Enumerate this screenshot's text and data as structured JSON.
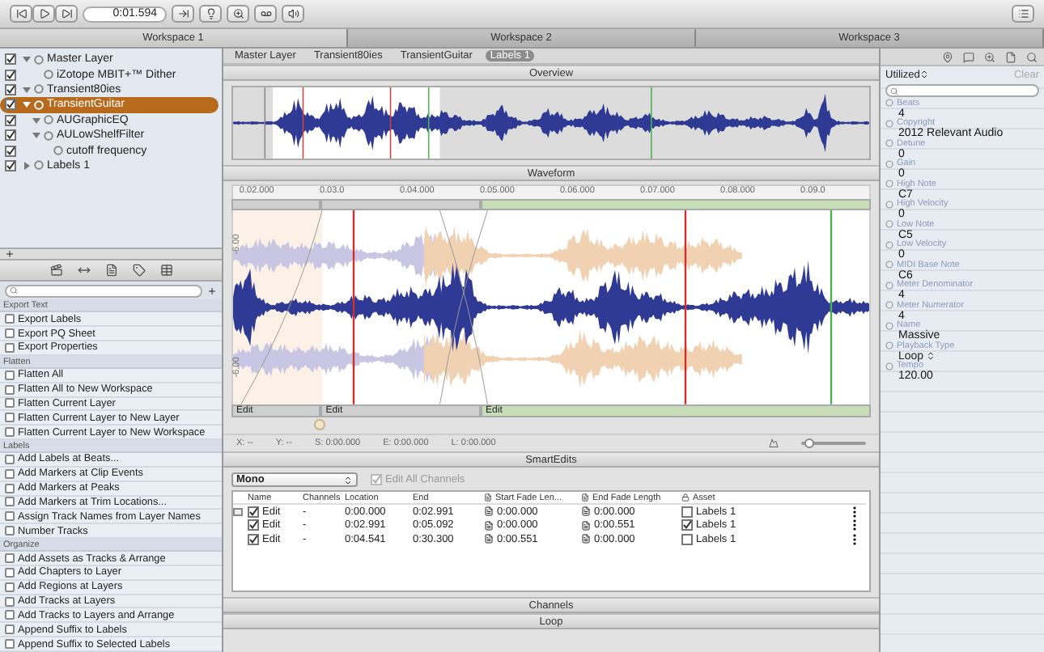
{
  "toolbar": {
    "time": "0:01.594"
  },
  "workspace_tabs": [
    {
      "label": "Workspace 1",
      "selected": true
    },
    {
      "label": "Workspace 2",
      "selected": false
    },
    {
      "label": "Workspace 3",
      "selected": false
    }
  ],
  "layers": [
    {
      "label": "Master Layer",
      "checked": true,
      "expanded": true,
      "selected": false,
      "children": [
        {
          "label": "iZotope MBIT+™ Dither",
          "checked": true,
          "selected": false
        }
      ]
    },
    {
      "label": "Transient80ies",
      "checked": true,
      "expanded": true,
      "selected": false
    },
    {
      "label": "TransientGuitar",
      "checked": true,
      "expanded": true,
      "selected": true,
      "children": [
        {
          "label": "AUGraphicEQ",
          "checked": true,
          "expanded": true,
          "selected": false
        },
        {
          "label": "AULowShelfFilter",
          "checked": true,
          "expanded": true,
          "selected": false,
          "children": [
            {
              "label": "cutoff frequency",
              "checked": true,
              "selected": false
            }
          ]
        }
      ]
    },
    {
      "label": "Labels 1",
      "checked": true,
      "expanded": false,
      "selected": false
    }
  ],
  "scripts": [
    {
      "title": "Export Text",
      "items": [
        "Export Labels",
        "Export PQ Sheet",
        "Export Properties"
      ]
    },
    {
      "title": "Flatten",
      "items": [
        "Flatten All",
        "Flatten All to New Workspace",
        "Flatten Current Layer",
        "Flatten Current Layer to New Layer",
        "Flatten Current Layer to New Workspace"
      ]
    },
    {
      "title": "Labels",
      "items": [
        "Add Labels at Beats...",
        "Add Markers at Clip Events",
        "Add Markers at Peaks",
        "Add Markers at Trim Locations...",
        "Assign Track Names from Layer Names",
        "Number Tracks"
      ]
    },
    {
      "title": "Organize",
      "items": [
        "Add Assets as Tracks & Arrange",
        "Add Chapters to Layer",
        "Add Regions at Layers",
        "Add Tracks at Layers",
        "Add Tracks to Layers and Arrange",
        "Append Suffix to Labels",
        "Append Suffix to Selected Labels"
      ]
    }
  ],
  "breadcrumbs": [
    {
      "label": "Master Layer",
      "selected": false
    },
    {
      "label": "Transient80ies",
      "selected": false
    },
    {
      "label": "TransientGuitar",
      "selected": false
    },
    {
      "label": "Labels 1",
      "selected": true
    }
  ],
  "overview": {
    "title": "Overview"
  },
  "waveform": {
    "title": "Waveform",
    "ruler": [
      "0.02.000",
      "0.03.0",
      "0.04.000",
      "0.05.000",
      "0.06.000",
      "0.07.000",
      "0.08.000",
      "0.09.0"
    ],
    "scale": [
      "-6.00",
      "-6.00"
    ],
    "clips": [
      "Edit",
      "Edit",
      "Edit"
    ]
  },
  "status": {
    "items": [
      "X: --",
      "Y: --",
      "S: 0:00.000",
      "E: 0:00.000",
      "L: 0:00.000"
    ],
    "zoom": {
      "level": 0.12
    }
  },
  "smart_edits": {
    "title": "SmartEdits",
    "mode": "Mono",
    "edit_all_channels": {
      "label": "Edit All Channels",
      "checked": true
    },
    "columns": [
      "Name",
      "Channels",
      "Location",
      "End",
      "Start Fade Len...",
      "End Fade Length",
      "Asset"
    ],
    "rows": [
      {
        "checked": true,
        "name": "Edit",
        "channels": "-",
        "location": "0:00.000",
        "end": "0:02.991",
        "start_fade": "0:00.000",
        "end_fade": "0:00.000",
        "asset": "Labels 1",
        "asset_checked": false
      },
      {
        "checked": true,
        "name": "Edit",
        "channels": "-",
        "location": "0:02.991",
        "end": "0:05.092",
        "start_fade": "0:00.000",
        "end_fade": "0:00.551",
        "asset": "Labels 1",
        "asset_checked": true
      },
      {
        "checked": true,
        "name": "Edit",
        "channels": "-",
        "location": "0:04.541",
        "end": "0:30.300",
        "start_fade": "0:00.551",
        "end_fade": "0:00.000",
        "asset": "Labels 1",
        "asset_checked": false
      }
    ]
  },
  "channels": {
    "title": "Channels"
  },
  "loop": {
    "title": "Loop"
  },
  "inspector": {
    "filter": "Utilized",
    "clear": "Clear",
    "properties": [
      {
        "name": "Beats",
        "value": "4",
        "kind": "text"
      },
      {
        "name": "Copyright",
        "value": "2012 Relevant Audio",
        "kind": "text"
      },
      {
        "name": "Detune",
        "value": "0",
        "kind": "text"
      },
      {
        "name": "Gain",
        "value": "0",
        "kind": "text"
      },
      {
        "name": "High Note",
        "value": "C7",
        "kind": "text"
      },
      {
        "name": "High Velocity",
        "value": "0",
        "kind": "text"
      },
      {
        "name": "Low Note",
        "value": "C5",
        "kind": "text"
      },
      {
        "name": "Low Velocity",
        "value": "0",
        "kind": "text"
      },
      {
        "name": "MIDI Base Note",
        "value": "C6",
        "kind": "text"
      },
      {
        "name": "Meter Denominator",
        "value": "4",
        "kind": "text"
      },
      {
        "name": "Meter Numerator",
        "value": "4",
        "kind": "text"
      },
      {
        "name": "Name",
        "value": "Massive",
        "kind": "text"
      },
      {
        "name": "Playback Type",
        "value": "Loop",
        "kind": "select"
      },
      {
        "name": "Tempo",
        "value": "120.00",
        "kind": "text"
      }
    ]
  }
}
